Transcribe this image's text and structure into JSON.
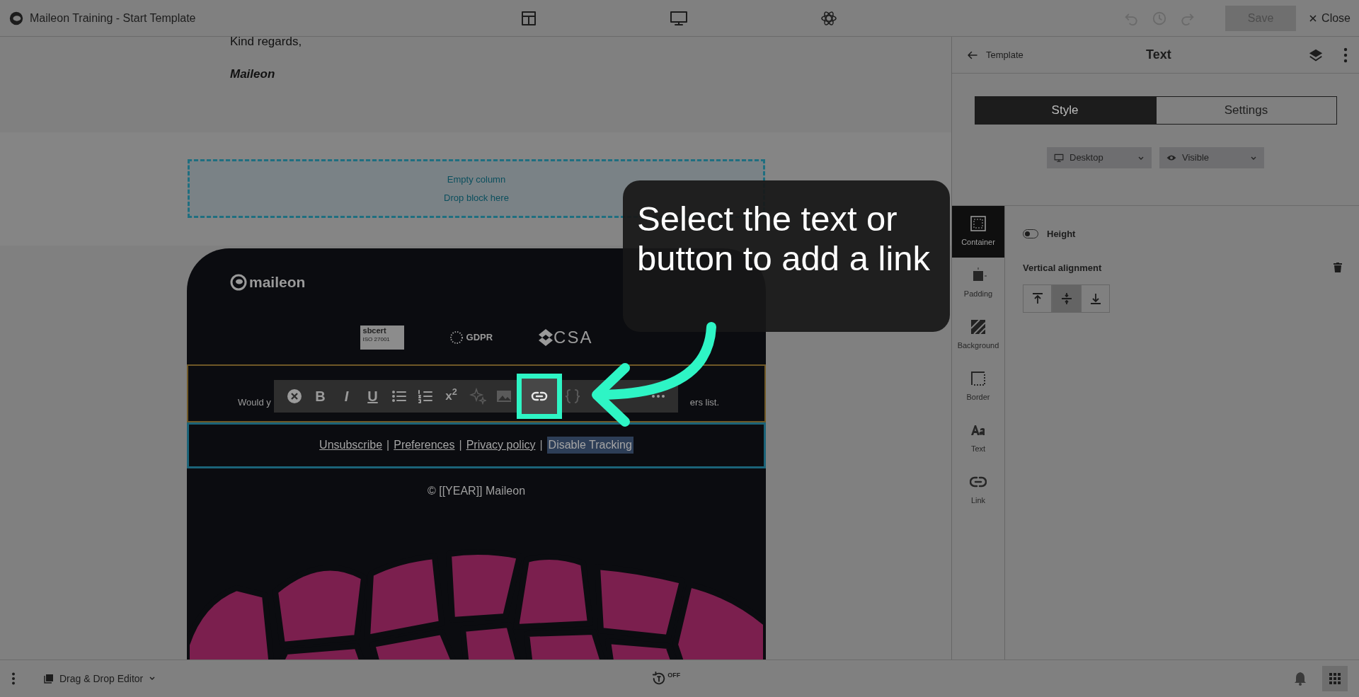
{
  "window": {
    "title": "Maileon Training - Start Template"
  },
  "top_actions": {
    "save": {
      "label": "Save",
      "disabled": true
    },
    "close": {
      "label": "Close"
    }
  },
  "email": {
    "greeting": "Kind regards,",
    "signature": "Maileon",
    "empty_column": {
      "line_1": "Empty column",
      "line_2": "Drop block here"
    },
    "logo_text": "maileon",
    "badges": [
      {
        "kind": "sbcert",
        "label": "sbcert",
        "sublabel": "ISO 27001"
      },
      {
        "kind": "gdpr",
        "label": "GDPR"
      },
      {
        "kind": "csa",
        "label": "CSA"
      }
    ],
    "notice_start": "Would y",
    "notice_end": "ers list.",
    "footer_links": [
      {
        "label": "Unsubscribe",
        "selected": false
      },
      {
        "label": "Preferences",
        "selected": false
      },
      {
        "label": "Privacy policy",
        "selected": false
      },
      {
        "label": "Disable Tracking",
        "selected": true
      }
    ],
    "separator": "|",
    "copyright": "© [[YEAR]] Maileon"
  },
  "format_toolbar": [
    {
      "kind": "clear",
      "highlighted": false
    },
    {
      "kind": "bold",
      "label": "B",
      "highlighted": false
    },
    {
      "kind": "italic",
      "label": "I",
      "highlighted": false
    },
    {
      "kind": "underline",
      "label": "U",
      "highlighted": false
    },
    {
      "kind": "bullets",
      "highlighted": false
    },
    {
      "kind": "numbered",
      "highlighted": false
    },
    {
      "kind": "superscript",
      "label": "x$^{2}$",
      "highlighted": false
    },
    {
      "kind": "ai",
      "highlighted": false
    },
    {
      "kind": "image",
      "highlighted": false
    },
    {
      "kind": "link",
      "highlighted": true
    },
    {
      "kind": "merge",
      "highlighted": false
    },
    {
      "kind": "more",
      "highlighted": false
    }
  ],
  "tooltip": {
    "text": "Select the text or button to add a link"
  },
  "panel": {
    "back_label": "Template",
    "title": "Text",
    "tabs": [
      {
        "label": "Style",
        "selected": true
      },
      {
        "label": "Settings",
        "selected": false
      }
    ],
    "device_dropdown": "Desktop",
    "visibility_dropdown": "Visible",
    "side_tabs": [
      {
        "kind": "container",
        "label": "Container",
        "selected": true
      },
      {
        "kind": "padding",
        "label": "Padding",
        "selected": false
      },
      {
        "kind": "background",
        "label": "Background",
        "selected": false
      },
      {
        "kind": "border",
        "label": "Border",
        "selected": false
      },
      {
        "kind": "text",
        "label": "Text",
        "selected": false
      },
      {
        "kind": "link",
        "label": "Link",
        "selected": false
      }
    ],
    "height_toggle": {
      "label": "Height",
      "on": false
    },
    "vertical_alignment": {
      "label": "Vertical alignment",
      "options": [
        {
          "kind": "top",
          "selected": false
        },
        {
          "kind": "middle",
          "selected": true
        },
        {
          "kind": "bottom",
          "selected": false
        }
      ]
    }
  },
  "bottom_bar": {
    "editor_label": "Drag & Drop Editor",
    "autosave": "OFF"
  }
}
